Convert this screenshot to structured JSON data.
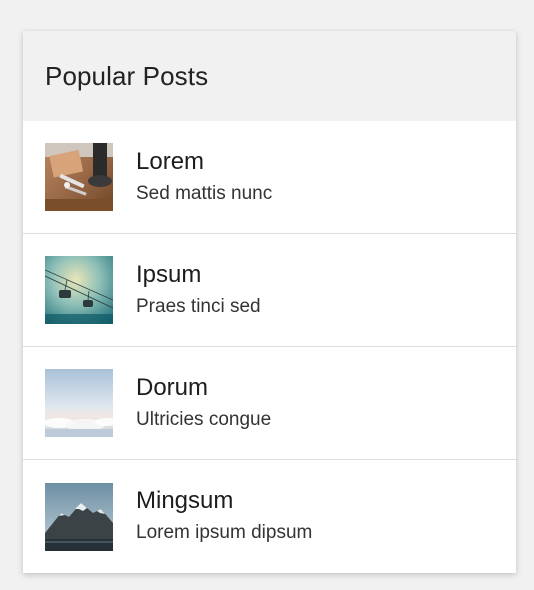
{
  "widget": {
    "title": "Popular Posts"
  },
  "posts": [
    {
      "title": "Lorem",
      "subtitle": "Sed mattis nunc",
      "thumbnail": "desk-tools-photo"
    },
    {
      "title": "Ipsum",
      "subtitle": "Praes tinci sed",
      "thumbnail": "cable-car-photo"
    },
    {
      "title": "Dorum",
      "subtitle": "Ultricies congue",
      "thumbnail": "sky-clouds-photo"
    },
    {
      "title": "Mingsum",
      "subtitle": "Lorem ipsum dipsum",
      "thumbnail": "mountain-lake-photo"
    }
  ],
  "colors": {
    "page_background": "#f1f1f1",
    "header_background": "#f1f1f1",
    "card_background": "#ffffff",
    "divider": "#dedede",
    "text": "#1d1d1d"
  }
}
